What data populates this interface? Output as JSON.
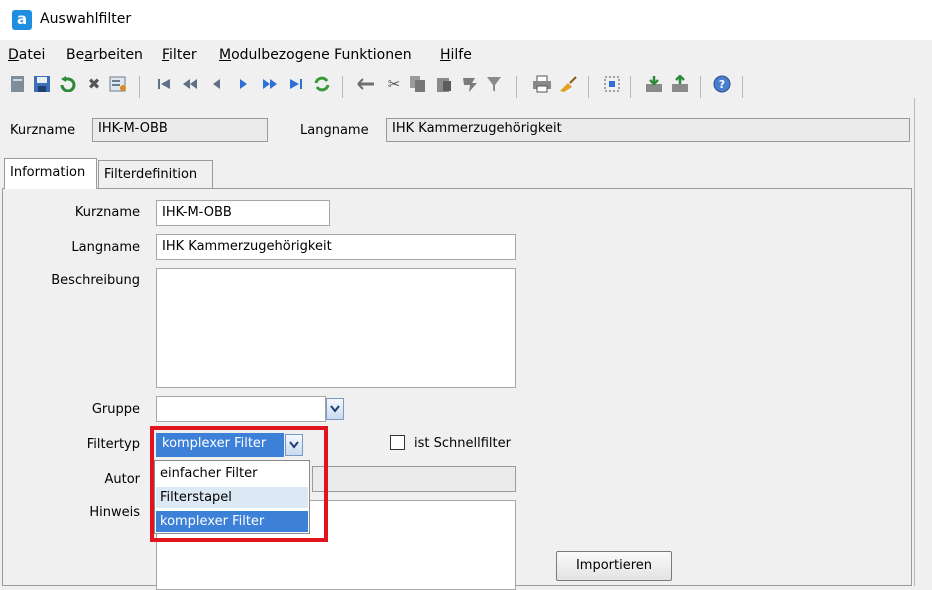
{
  "window": {
    "title": "Auswahlfilter",
    "logo_letter": "a"
  },
  "menu": [
    "Datei",
    "Bearbeiten",
    "Filter",
    "Modulbezogene Funktionen",
    "Hilfe"
  ],
  "toolbar": {
    "icons": [
      "new-icon",
      "save-icon",
      "undo-icon",
      "delete-icon",
      "properties-icon",
      "first-record-icon",
      "previous-page-icon",
      "previous-record-icon",
      "next-record-icon",
      "next-page-icon",
      "last-record-icon",
      "refresh-icon",
      "back-arrow-icon",
      "cut-icon",
      "copy-icon",
      "paste-icon",
      "paste-special-icon",
      "clear-icon",
      "print-icon",
      "broom-icon",
      "select-all-icon",
      "import-icon",
      "export-icon",
      "help-icon"
    ]
  },
  "header": {
    "kurzname_label": "Kurzname",
    "kurzname_value": "IHK-M-OBB",
    "langname_label": "Langname",
    "langname_value": "IHK Kammerzugehörigkeit"
  },
  "tabs": [
    "Information",
    "Filterdefinition"
  ],
  "form": {
    "kurzname_label": "Kurzname",
    "kurzname_value": "IHK-M-OBB",
    "langname_label": "Langname",
    "langname_value": "IHK Kammerzugehörigkeit",
    "beschreibung_label": "Beschreibung",
    "beschreibung_value": "",
    "gruppe_label": "Gruppe",
    "gruppe_value": "",
    "filtertyp_label": "Filtertyp",
    "filtertyp_value": "komplexer Filter",
    "schnellfilter_label": "ist Schnellfilter",
    "schnellfilter_checked": false,
    "autor_label": "Autor",
    "hinweis_label": "Hinweis",
    "import_label": "Importieren"
  },
  "dropdown": {
    "options": [
      "einfacher Filter",
      "Filterstapel",
      "komplexer Filter"
    ],
    "hovered": "Filterstapel",
    "selected": "komplexer Filter"
  },
  "colors": {
    "highlight": "#e0141c",
    "selection": "#3c80d8",
    "hover": "#dde8f5",
    "brand": "#1e8ee0"
  }
}
